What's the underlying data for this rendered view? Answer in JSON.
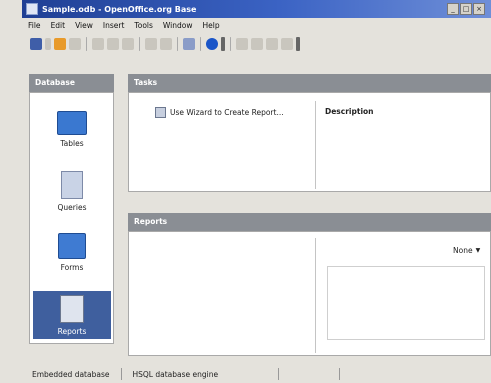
{
  "window": {
    "title": "Sample.odb - OpenOffice.org Base"
  },
  "window_buttons": [
    "_",
    "□",
    "×"
  ],
  "menu": [
    "File",
    "Edit",
    "View",
    "Insert",
    "Tools",
    "Window",
    "Help"
  ],
  "toolbar": {
    "icons": [
      "new-document-icon",
      "dropdown-arrow-icon",
      "open-icon",
      "save-icon",
      "cut-icon",
      "copy-icon",
      "paste-icon",
      "sort-icon",
      "sort-desc-icon",
      "form-icon",
      "help-icon",
      "grip-icon",
      "table-icon",
      "edit-icon",
      "delete-icon",
      "rename-icon",
      "grip-icon"
    ]
  },
  "sidebar": {
    "header": "Database",
    "items": [
      {
        "label": "Tables",
        "icon": "tables-icon"
      },
      {
        "label": "Queries",
        "icon": "queries-icon"
      },
      {
        "label": "Forms",
        "icon": "forms-icon"
      },
      {
        "label": "Reports",
        "icon": "reports-icon",
        "selected": true
      }
    ]
  },
  "tasks": {
    "header": "Tasks",
    "items": [
      {
        "label": "Use Wizard to Create Report...",
        "icon": "wizard-icon"
      }
    ],
    "description_label": "Description"
  },
  "reports": {
    "header": "Reports",
    "preview_select": "None"
  },
  "status": {
    "left": "Embedded database",
    "middle": "HSQL database engine"
  }
}
